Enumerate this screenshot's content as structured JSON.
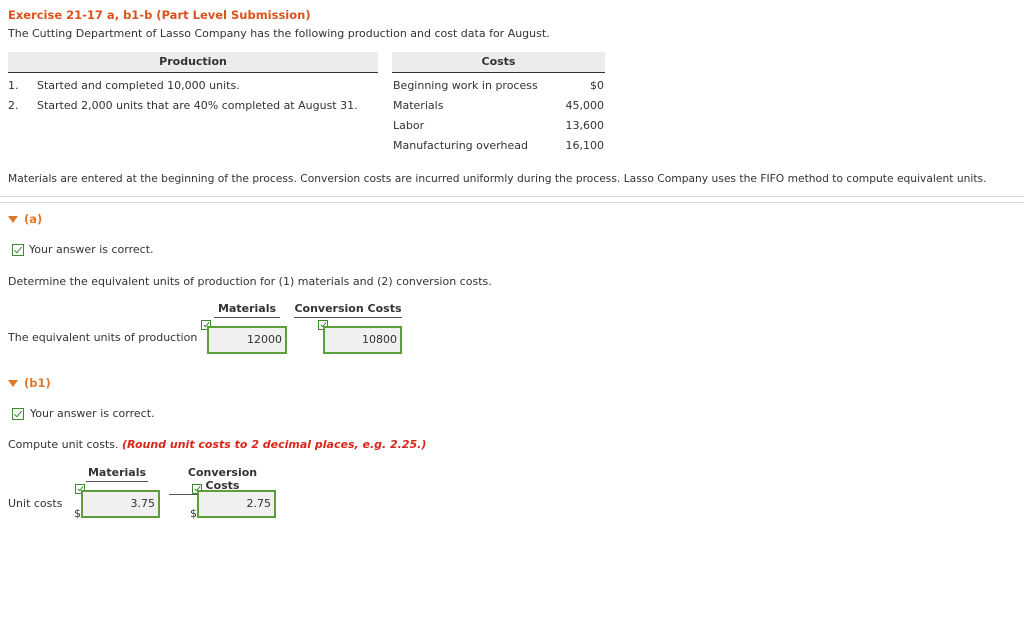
{
  "header": {
    "title": "Exercise 21-17 a, b1-b (Part Level Submission)",
    "intro": "The Cutting Department of Lasso Company has the following production and cost data for August."
  },
  "production": {
    "heading": "Production",
    "items": [
      {
        "num": "1.",
        "text": "Started and completed 10,000 units."
      },
      {
        "num": "2.",
        "text": "Started 2,000 units that are 40% completed at August 31."
      }
    ]
  },
  "costs": {
    "heading": "Costs",
    "items": [
      {
        "label": "Beginning work in process",
        "value": "$0"
      },
      {
        "label": "Materials",
        "value": "45,000"
      },
      {
        "label": "Labor",
        "value": "13,600"
      },
      {
        "label": "Manufacturing overhead",
        "value": "16,100"
      }
    ]
  },
  "note": "Materials are entered at the beginning of the process. Conversion costs are incurred uniformly during the process. Lasso Company uses the FIFO method to compute equivalent units.",
  "part_a": {
    "label": "(a)",
    "status": "Your answer is correct.",
    "instruction": "Determine the equivalent units of production for (1) materials and (2) conversion costs.",
    "col_materials": "Materials",
    "col_conversion": "Conversion Costs",
    "row_label": "The equivalent units of production",
    "materials_value": "12000",
    "conversion_value": "10800"
  },
  "part_b1": {
    "label": "(b1)",
    "status": "Your answer is correct.",
    "instruction_plain": "Compute unit costs. ",
    "instruction_red": "(Round unit costs to 2 decimal places, e.g. 2.25.)",
    "col_materials": "Materials",
    "col_conversion": "Conversion Costs",
    "row_label": "Unit costs",
    "currency": "$",
    "materials_value": "3.75",
    "conversion_value": "2.75"
  },
  "colors": {
    "accent": "#d9531e",
    "correct": "#5d9e3c",
    "hint": "#d9251a"
  }
}
